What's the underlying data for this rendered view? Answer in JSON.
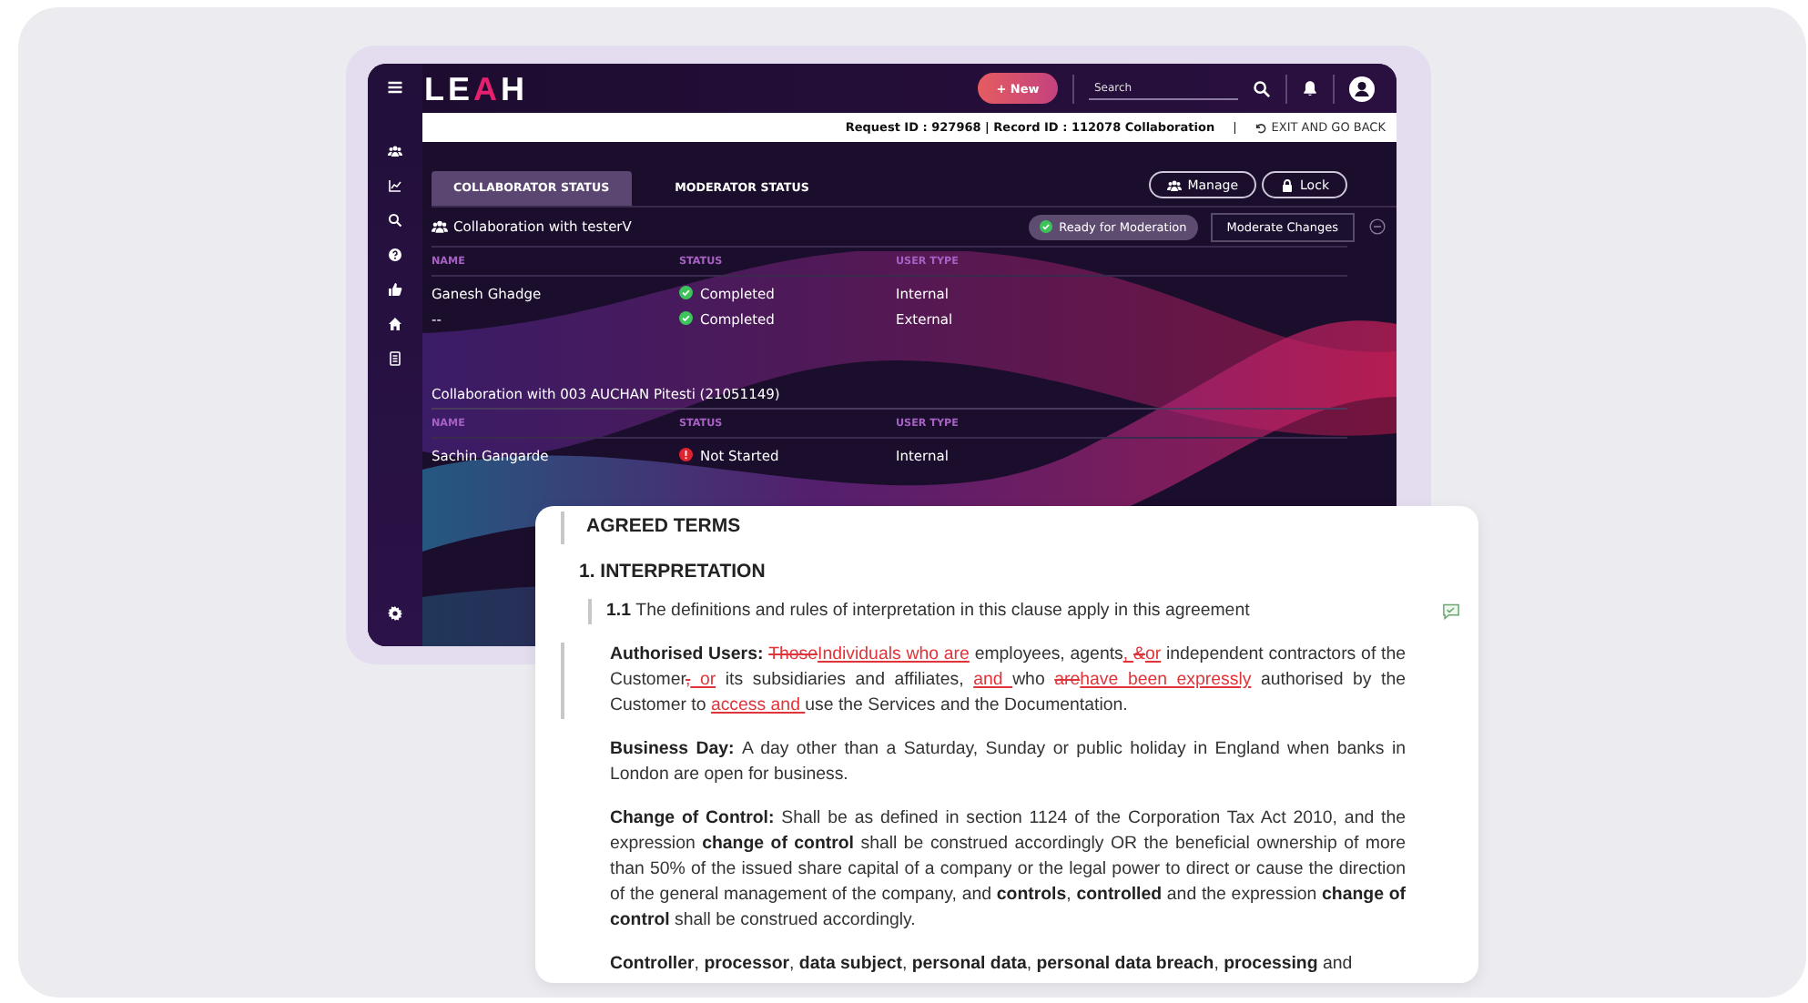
{
  "app": {
    "logo": [
      {
        "text": "LE",
        "accent": false
      },
      {
        "text": "A",
        "accent": true
      },
      {
        "text": "H",
        "accent": false
      }
    ],
    "new_button": "+ New",
    "search": {
      "placeholder": "Search"
    },
    "info_bar": {
      "record": "Request ID : 927968 | Record ID : 112078 Collaboration",
      "separator": "|",
      "exit": "EXIT AND GO BACK"
    },
    "tabs": [
      {
        "label": "COLLABORATOR STATUS",
        "selected": true
      },
      {
        "label": "MODERATOR STATUS",
        "selected": false
      }
    ],
    "actions": [
      {
        "label": "Manage",
        "kind": "manage"
      },
      {
        "label": "Lock",
        "kind": "lock"
      }
    ],
    "groups": [
      {
        "title": "Collaboration with testerV",
        "kind": "team",
        "badge": "Ready for Moderation",
        "action": "Moderate Changes",
        "columns": [
          "NAME",
          "STATUS",
          "USER TYPE"
        ],
        "rows": [
          {
            "name": "Ganesh Ghadge",
            "status": "Completed",
            "kind": "done",
            "user_type": "Internal"
          },
          {
            "name": "--",
            "status": "Completed",
            "kind": "done",
            "user_type": "External"
          }
        ]
      },
      {
        "title": "Collaboration with 003 AUCHAN Pitesti (21051149)",
        "kind": "plain",
        "columns": [
          "NAME",
          "STATUS",
          "USER TYPE"
        ],
        "rows": [
          {
            "name": "Sachin Gangarde",
            "status": "Not Started",
            "kind": "pending",
            "user_type": "Internal"
          }
        ]
      }
    ]
  },
  "document": {
    "heading": {
      "text": "AGREED TERMS",
      "changed": true
    },
    "section": "1. INTERPRETATION",
    "paragraphs": [
      {
        "kind": "clause",
        "number": "1.1",
        "changed": true,
        "comment": true,
        "segments": [
          {
            "kind": "text",
            "text": "The definitions and rules of interpretation in this clause apply in this agreement"
          }
        ]
      },
      {
        "kind": "definition",
        "changed": true,
        "segments": [
          {
            "kind": "bold",
            "text": "Authorised Users: "
          },
          {
            "kind": "del",
            "text": "Those"
          },
          {
            "kind": "ins",
            "text": "Individuals who are"
          },
          {
            "kind": "text",
            "text": " employees, agents"
          },
          {
            "kind": "ins",
            "text": ", "
          },
          {
            "kind": "del",
            "text": "&"
          },
          {
            "kind": "ins",
            "text": "or"
          },
          {
            "kind": "text",
            "text": " independent contractors of the Customer"
          },
          {
            "kind": "del",
            "text": ","
          },
          {
            "kind": "ins",
            "text": " or"
          },
          {
            "kind": "text",
            "text": " its subsidiaries and affiliates, "
          },
          {
            "kind": "ins",
            "text": "and "
          },
          {
            "kind": "text",
            "text": "who "
          },
          {
            "kind": "del",
            "text": "are"
          },
          {
            "kind": "ins",
            "text": "have been expressly"
          },
          {
            "kind": "text",
            "text": " authorised by the Customer to "
          },
          {
            "kind": "ins",
            "text": "access and "
          },
          {
            "kind": "text",
            "text": "use the Services and the Documentation."
          }
        ]
      },
      {
        "kind": "definition",
        "changed": false,
        "segments": [
          {
            "kind": "bold",
            "text": "Business Day: "
          },
          {
            "kind": "text",
            "text": "A day other than a Saturday, Sunday or public holiday in England when banks in London are open for business."
          }
        ]
      },
      {
        "kind": "definition",
        "changed": false,
        "segments": [
          {
            "kind": "bold",
            "text": "Change of Control: "
          },
          {
            "kind": "text",
            "text": "Shall be as defined in section 1124 of the Corporation Tax Act 2010, and the expression "
          },
          {
            "kind": "bold",
            "text": "change of control"
          },
          {
            "kind": "text",
            "text": " shall be construed accordingly OR the beneficial ownership of more than 50% of the issued share capital of a company or the legal power to direct or cause the direction of the general management of the company, and "
          },
          {
            "kind": "bold",
            "text": "controls"
          },
          {
            "kind": "text",
            "text": ", "
          },
          {
            "kind": "bold",
            "text": "controlled"
          },
          {
            "kind": "text",
            "text": " and the expression "
          },
          {
            "kind": "bold",
            "text": "change of control"
          },
          {
            "kind": "text",
            "text": " shall be construed accordingly."
          }
        ]
      },
      {
        "kind": "definition",
        "changed": false,
        "segments": [
          {
            "kind": "bold",
            "text": "Controller"
          },
          {
            "kind": "text",
            "text": ", "
          },
          {
            "kind": "bold",
            "text": "processor"
          },
          {
            "kind": "text",
            "text": ", "
          },
          {
            "kind": "bold",
            "text": "data subject"
          },
          {
            "kind": "text",
            "text": ", "
          },
          {
            "kind": "bold",
            "text": "personal data"
          },
          {
            "kind": "text",
            "text": ", "
          },
          {
            "kind": "bold",
            "text": "personal data breach"
          },
          {
            "kind": "text",
            "text": ", "
          },
          {
            "kind": "bold",
            "text": "processing"
          },
          {
            "kind": "text",
            "text": " and"
          }
        ]
      }
    ]
  }
}
